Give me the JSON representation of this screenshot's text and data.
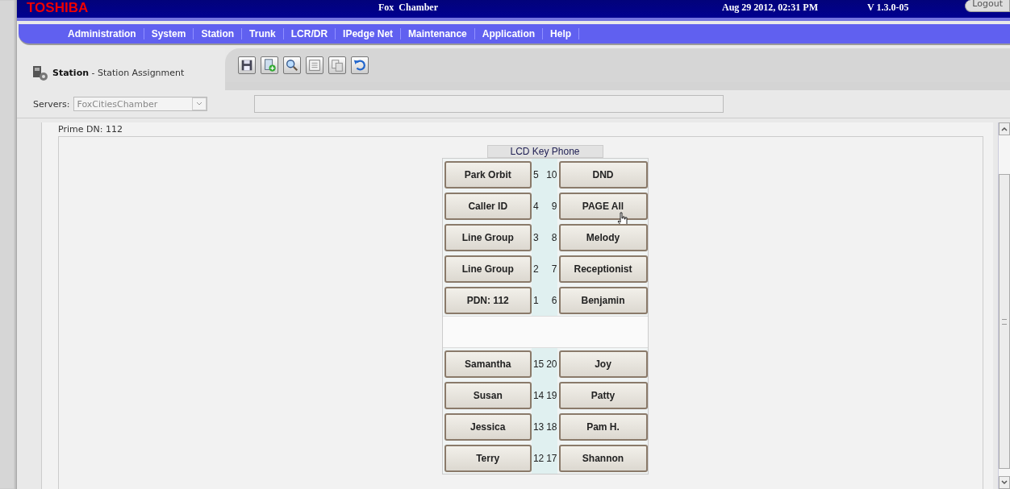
{
  "header": {
    "logo": "TOSHIBA",
    "site": "Fox  Chamber",
    "datetime": "Aug 29 2012, 02:31 PM",
    "version": "V 1.3.0-05",
    "logout": "Logout"
  },
  "menu": [
    "Administration",
    "System",
    "Station",
    "Trunk",
    "LCR/DR",
    "IPedge Net",
    "Maintenance",
    "Application",
    "Help"
  ],
  "page_title": "**Station** - Station Assignment",
  "toolbar": [
    {
      "kind": "save"
    },
    {
      "kind": "add"
    },
    {
      "kind": "search"
    },
    {
      "kind": "list"
    },
    {
      "kind": "copy"
    },
    {
      "kind": "undo"
    }
  ],
  "servers": {
    "label": "Servers:",
    "value": "FoxCitiesChamber"
  },
  "prime_dn": "Prime DN: 112",
  "phone": {
    "title": "LCD Key Phone",
    "upper_rows": [
      {
        "left": "Park Orbit",
        "left_number": "5",
        "right_number": "10",
        "right": "DND"
      },
      {
        "left": "Caller ID",
        "left_number": "4",
        "right_number": "9",
        "right": "PAGE All"
      },
      {
        "left": "Line Group",
        "left_number": "3",
        "right_number": "8",
        "right": "Melody"
      },
      {
        "left": "Line Group",
        "left_number": "2",
        "right_number": "7",
        "right": "Receptionist"
      },
      {
        "left": "PDN: 112",
        "left_number": "1",
        "right_number": "6",
        "right": "Benjamin"
      }
    ],
    "lower_rows": [
      {
        "left": "Samantha",
        "left_number": "15",
        "right_number": "20",
        "right": "Joy"
      },
      {
        "left": "Susan",
        "left_number": "14",
        "right_number": "19",
        "right": "Patty"
      },
      {
        "left": "Jessica",
        "left_number": "13",
        "right_number": "18",
        "right": "Pam H."
      },
      {
        "left": "Terry",
        "left_number": "12",
        "right_number": "17",
        "right": "Shannon"
      }
    ]
  }
}
